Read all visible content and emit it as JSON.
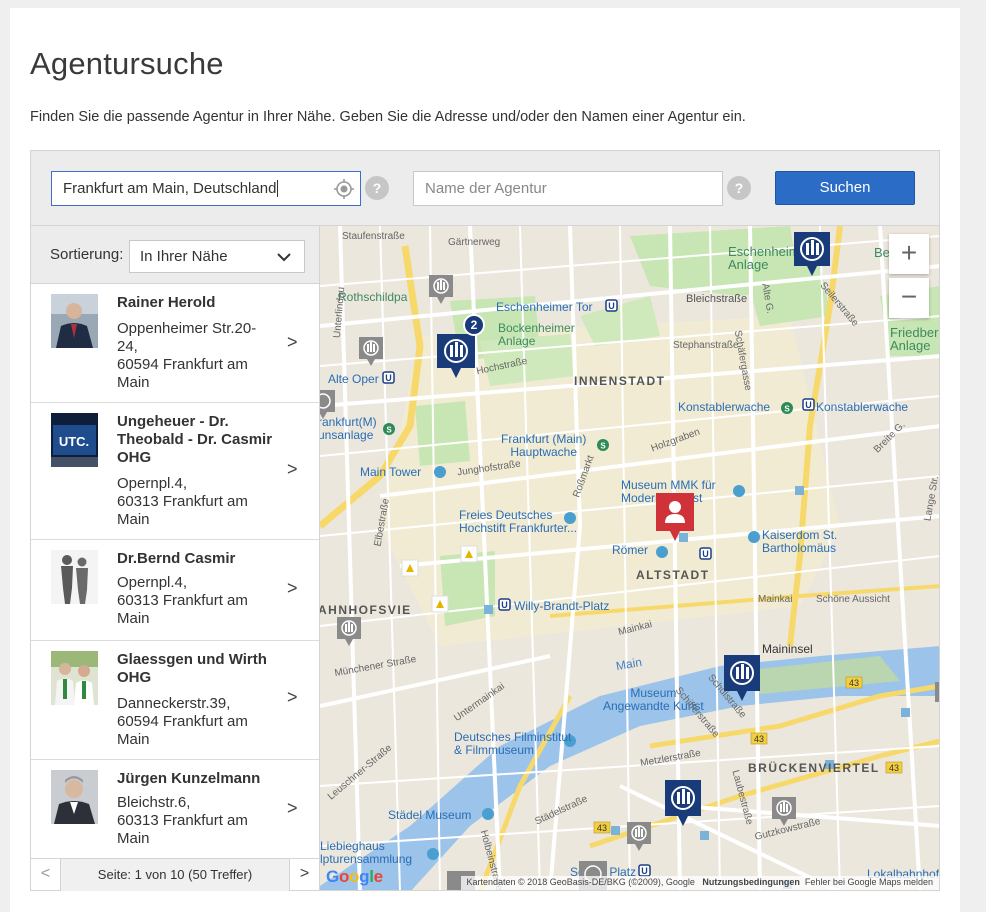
{
  "page": {
    "title": "Agentursuche",
    "intro": "Finden Sie die passende Agentur in Ihrer Nähe. Geben Sie die Adresse und/oder den Namen einer Agentur ein."
  },
  "search": {
    "location_value": "Frankfurt am Main, Deutschland",
    "help_label": "?",
    "name_placeholder": "Name der Agentur",
    "button_label": "Suchen"
  },
  "sort": {
    "label": "Sortierung:",
    "selected": "In Ihrer Nähe"
  },
  "agents": [
    {
      "name": "Rainer Herold",
      "address": [
        "Oppenheimer Str.20-",
        "24,",
        "60594 Frankfurt am",
        "Main"
      ]
    },
    {
      "name": "Ungeheuer - Dr. Theobald - Dr. Casmir OHG",
      "name_lines": [
        "Ungeheuer - Dr.",
        "Theobald - Dr. Casmir",
        "OHG"
      ],
      "address": [
        "Opernpl.4,",
        "60313 Frankfurt am",
        "Main"
      ]
    },
    {
      "name": "Dr.Bernd Casmir",
      "address": [
        "Opernpl.4,",
        "60313 Frankfurt am",
        "Main"
      ]
    },
    {
      "name": "Glaessgen und Wirth OHG",
      "name_lines": [
        "Glaessgen und Wirth",
        "OHG"
      ],
      "address": [
        "Danneckerstr.39,",
        "60594 Frankfurt am",
        "Main"
      ]
    },
    {
      "name": "Jürgen Kunzelmann",
      "address": [
        "Bleichstr.6,",
        "60313 Frankfurt am",
        "Main"
      ]
    }
  ],
  "agent_arrow": ">",
  "pager": {
    "prev": "<",
    "next": ">",
    "text": "Seite: 1 von 10 (50 Treffer)"
  },
  "map": {
    "zoom_in": "+",
    "zoom_out": "−",
    "cluster_count": "2",
    "labels": {
      "innenstadt": "INNENSTADT",
      "altstadt": "ALTSTADT",
      "bahnhofsviertel": "AHNHOFSVIE",
      "brueckenviertel": "BRÜCKENVIERTEL",
      "eschenheimer_tor": "Eschenheimer Tor",
      "bockenheimer_anlage": "Bockenheimer\nAnlage",
      "alte_oper": "Alte Oper",
      "konstablerwache_1": "Konstablerwache",
      "konstablerwache_2": "Konstablerwache",
      "hauptwache": "Frankfurt (Main)\nHauptwache",
      "main_tower": "Main Tower",
      "museum_mmk": "Museum MMK für\nModerne Kunst",
      "freies_deutsches": "Freies Deutsches\nHochstift Frankfurter...",
      "roemer": "Römer",
      "kaiserdom": "Kaiserdom St.\nBartholomäus",
      "willy_brandt": "Willy-Brandt-Platz",
      "maininsel": "Maininsel",
      "main": "Main",
      "museum_angewandte": "Museum\nAngewandte Kunst",
      "filmmuseum": "Deutsches Filminstitut\n& Filmmuseum",
      "staedel": "Städel Museum",
      "liebieghaus": "Liebieghaus\nlpturensammlung",
      "eschenheimer_anlage": "Eschenheimer\nAnlage",
      "bethmann": "Bethma",
      "friedberger": "Friedberg\nAnlage",
      "rothschildpark": "Rothschildpa",
      "frankfurt_m_anlage": "rankfurt(M)\nunsanlage",
      "schwed_platz": "Schwe    Platz",
      "lokalbahnhof": "Lokalbahnhof",
      "bleichstrasse": "Bleichstraße",
      "hochstrasse": "Hochstraße",
      "stephanstrasse": "Stephanstraße",
      "schoene_aussicht": "Schöne Aussicht",
      "mainkai_1": "Mainkai",
      "mainkai_2": "Mainkai",
      "untermainkai": "Untermainkai",
      "seilerstrasse": "Seilerstraße",
      "staufenstrasse": "Staufenstraße",
      "gaertnerweg": "Gärtnerweg",
      "junghofstrasse": "Junghofstraße",
      "rossmarkt": "Roßmarkt",
      "holzgraben": "Holzgraben",
      "muenchener": "Münchener Straße",
      "schulstrasse": "Schulstraße",
      "schifferstrasse": "Schifferstraße",
      "metzlerstrasse": "Metzlerstraße",
      "laubestrasse": "Laubestraße",
      "gutzkowstrasse": "Gutzkowstraße",
      "holbeinstrasse": "Holbeinstraße",
      "staedelstrasse": "Städelstraße",
      "leuschner": "Leuschner-Straße",
      "lange_str": "Lange Str.",
      "alte_g": "Alte G.",
      "breite_g": "Breite G.",
      "schaefergasse": "Schäfergasse",
      "elbestrasse": "Elbestraße",
      "taunusanlage_street": "Unterlindau"
    },
    "route_badges": [
      "43",
      "43",
      "43",
      "43"
    ],
    "google_logo": "Google",
    "attribution": "Kartendaten © 2018 GeoBasis-DE/BKG (©2009), Google",
    "terms": "Nutzungsbedingungen",
    "report": "Fehler bei Google Maps melden",
    "colors": {
      "agency_pin": "#1a3b7a",
      "agency_pin_gray": "#8a8a8a",
      "user_pin": "#d0323a",
      "park": "#c8e6b4",
      "water": "#9cc3ea",
      "road_major": "#f7d96b",
      "road": "#ffffff"
    }
  }
}
